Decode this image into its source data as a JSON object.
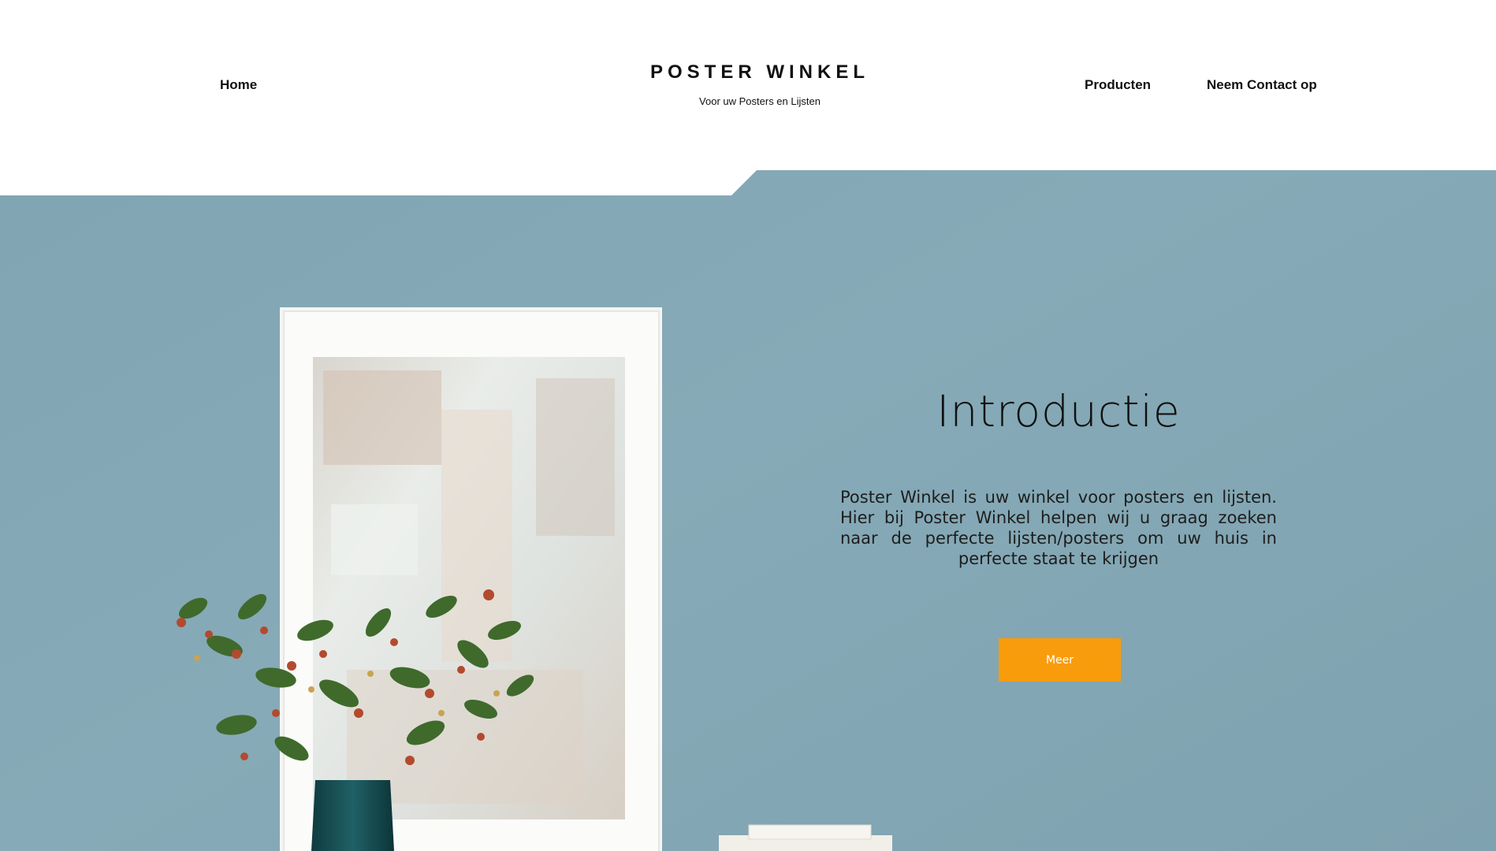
{
  "nav": {
    "home": "Home",
    "producten": "Producten",
    "contact": "Neem Contact op"
  },
  "brand": {
    "title": "POSTER WINKEL",
    "subtitle": "Voor uw Posters en Lijsten"
  },
  "hero": {
    "title": "Introductie",
    "text": "Poster Winkel is uw winkel voor posters en lijsten. Hier bij Poster Winkel helpen wij u graag zoeken naar de perfecte lijsten/posters om uw huis in perfecte staat te krijgen",
    "button_label": "Meer"
  },
  "colors": {
    "wall": "#85a9b6",
    "accent": "#f99c0c",
    "header_bg": "#ffffff"
  }
}
